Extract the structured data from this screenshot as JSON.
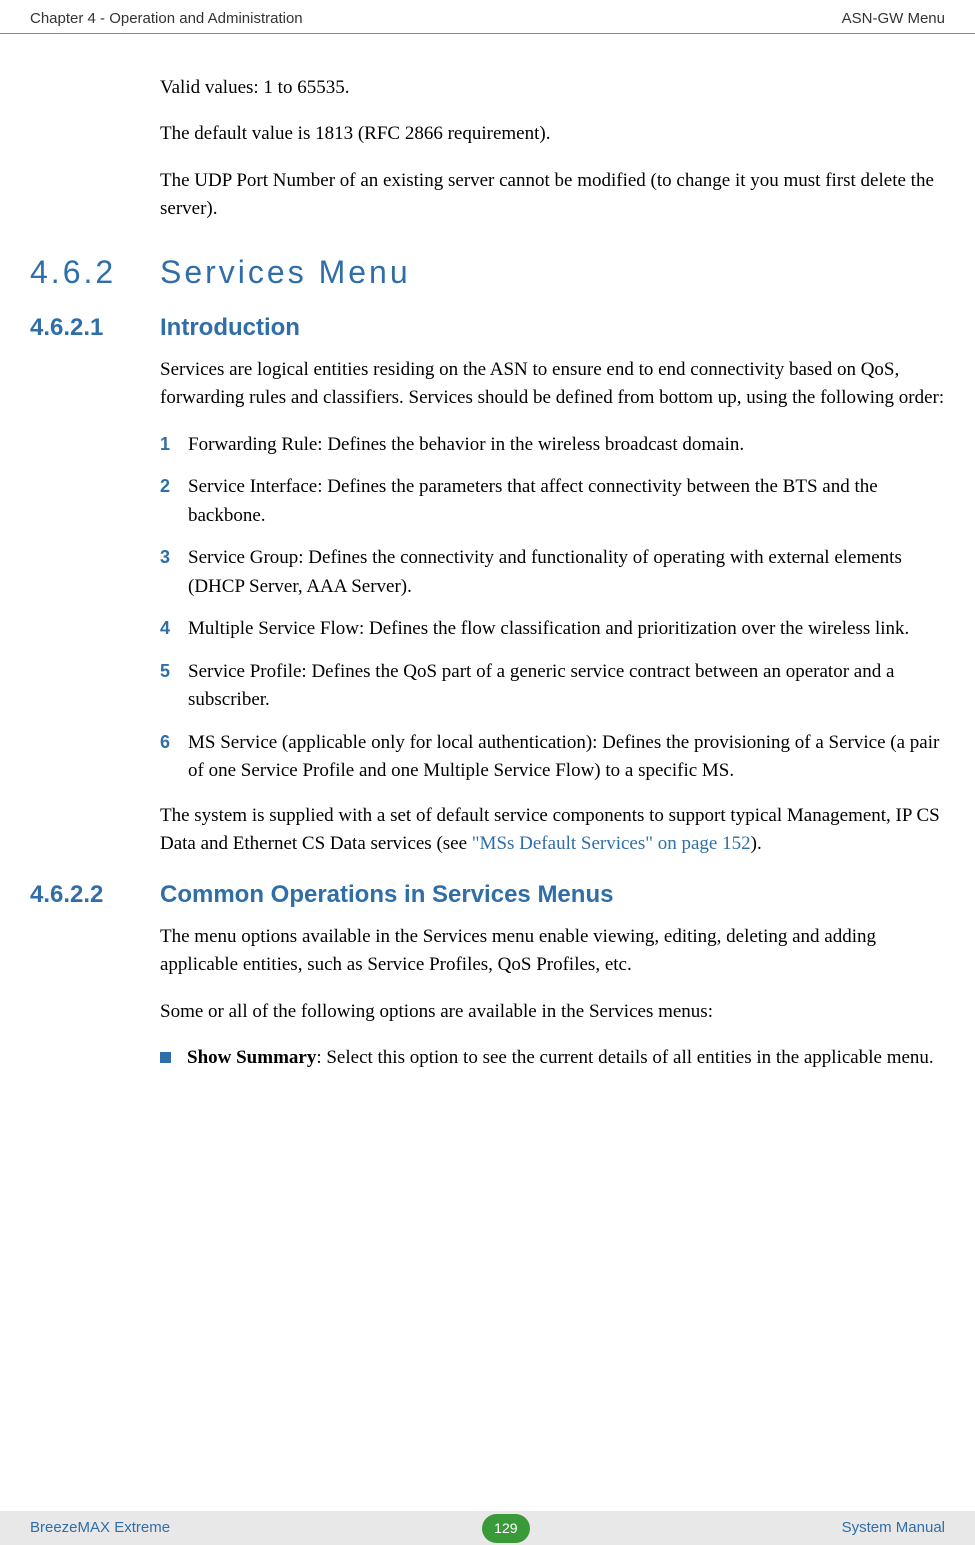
{
  "header": {
    "left": "Chapter 4 - Operation and Administration",
    "right": "ASN-GW Menu"
  },
  "intro_paras": [
    "Valid values: 1 to 65535.",
    "The default value is 1813 (RFC 2866 requirement).",
    "The UDP Port Number of an existing server cannot be modified (to change it you must first delete the server)."
  ],
  "section_462": {
    "num": "4.6.2",
    "title": "Services Menu"
  },
  "section_4621": {
    "num": "4.6.2.1",
    "title": "Introduction",
    "lead": "Services are logical entities residing on the ASN to ensure end to end connectivity based on QoS, forwarding rules and classifiers. Services should be defined from bottom up, using the following order:",
    "items": [
      "Forwarding Rule: Defines the behavior in the wireless broadcast domain.",
      "Service Interface: Defines the parameters that affect connectivity between the BTS and the backbone.",
      "Service Group: Defines the connectivity and functionality of operating with external elements (DHCP Server, AAA Server).",
      "Multiple Service Flow: Defines the flow classification and prioritization over the wireless link.",
      "Service Profile: Defines the QoS part of a generic service contract between an operator and a subscriber.",
      "MS Service (applicable only for local authentication): Defines the provisioning of a Service (a pair of one Service Profile and one Multiple Service Flow) to a specific MS."
    ],
    "trailer_pre": "The system is supplied with a set of default service components to support typical Management, IP CS Data and Ethernet CS Data services (see ",
    "trailer_link": "\"MSs Default Services\" on page 152",
    "trailer_post": ")."
  },
  "section_4622": {
    "num": "4.6.2.2",
    "title": "Common Operations in Services Menus",
    "paras": [
      "The menu options available in the Services menu enable viewing, editing, deleting and adding applicable entities, such as Service Profiles, QoS Profiles, etc.",
      "Some or all of the following options are available in the Services menus:"
    ],
    "bullet_label": "Show Summary",
    "bullet_text": ": Select this option to see the current details of all entities in the applicable menu."
  },
  "footer": {
    "left": "BreezeMAX Extreme",
    "page": "129",
    "right": "System Manual"
  }
}
